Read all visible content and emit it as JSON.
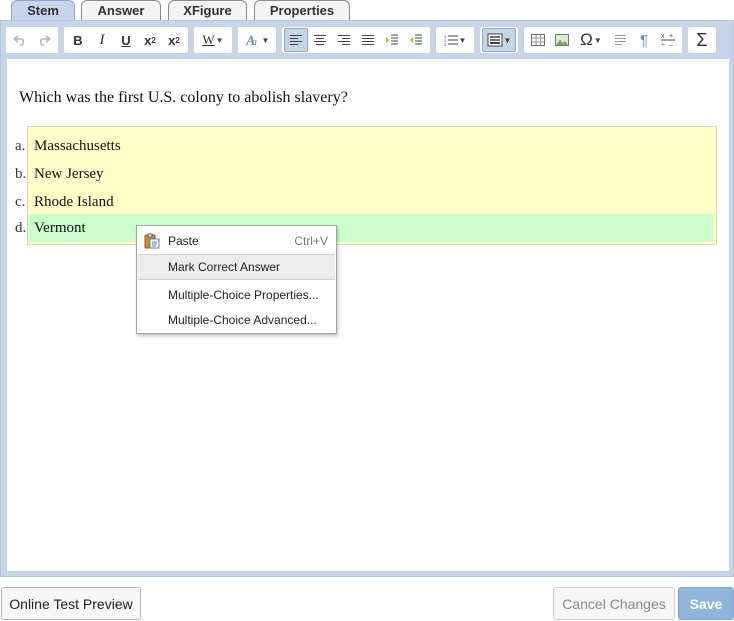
{
  "tabs": [
    {
      "label": "Stem"
    },
    {
      "label": "Answer"
    },
    {
      "label": "XFigure"
    },
    {
      "label": "Properties"
    }
  ],
  "toolbar": {
    "bold": "B",
    "italic": "I",
    "underline": "U",
    "font_color": "W",
    "special_chars": "Ω",
    "paragraph": "¶",
    "sum": "Σ",
    "icons": [
      "undo-icon",
      "redo-icon",
      "bold-icon",
      "italic-icon",
      "underline-icon",
      "subscript-icon",
      "superscript-icon",
      "font-color-icon",
      "text-style-icon",
      "align-left-icon",
      "align-center-icon",
      "align-right-icon",
      "justify-icon",
      "indent-icon",
      "outdent-icon",
      "numbered-list-icon",
      "multiple-choice-layout-icon",
      "table-icon",
      "image-icon",
      "special-characters-icon",
      "line-spacing-icon",
      "paragraph-mark-icon",
      "fraction-icon",
      "math-sum-icon"
    ]
  },
  "question": {
    "text": "Which was the first U.S. colony to abolish slavery?"
  },
  "choices": [
    {
      "letter": "a.",
      "text": "Massachusetts"
    },
    {
      "letter": "b.",
      "text": "New Jersey"
    },
    {
      "letter": "c.",
      "text": "Rhode Island"
    },
    {
      "letter": "d.",
      "text": "Vermont"
    }
  ],
  "context_menu": {
    "items": [
      {
        "label": "Paste",
        "shortcut": "Ctrl+V",
        "icon": "paste-icon"
      },
      {
        "label": "Mark Correct Answer"
      },
      {
        "label": "Multiple-Choice Properties..."
      },
      {
        "label": "Multiple-Choice Advanced..."
      }
    ]
  },
  "footer": {
    "preview_label": "Online Test Preview",
    "cancel_label": "Cancel Changes",
    "save_label": "Save"
  },
  "colors": {
    "frame": "#c5d6ea",
    "choices_background": "#ffffc8",
    "correct_answer_highlight": "#ccffcc",
    "save_button": "#8eb6dd"
  }
}
